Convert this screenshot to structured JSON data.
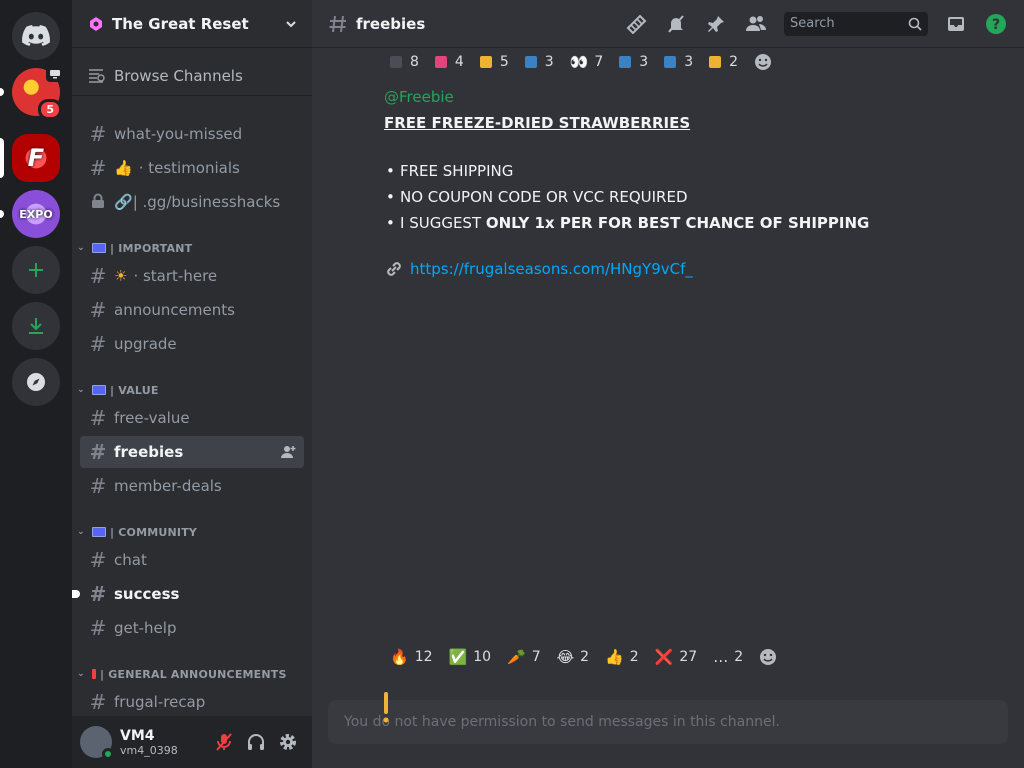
{
  "server": {
    "name": "The Great Reset"
  },
  "rail": {
    "badge_count": "5",
    "server_3_label": "EXPO"
  },
  "sidebar": {
    "browse_label": "Browse Channels",
    "channels_top": [
      {
        "name": "what-you-missed"
      },
      {
        "name": "· testimonials",
        "emoji": "👍"
      },
      {
        "name": "| .gg/businesshacks",
        "emoji": "🔗"
      }
    ],
    "categories": [
      {
        "label": "| IMPORTANT",
        "channels": [
          {
            "name": "· start-here",
            "emoji": "☀"
          },
          {
            "name": "announcements"
          },
          {
            "name": "upgrade"
          }
        ]
      },
      {
        "label": "| VALUE",
        "channels": [
          {
            "name": "free-value"
          },
          {
            "name": "freebies"
          },
          {
            "name": "member-deals"
          }
        ]
      },
      {
        "label": "| COMMUNITY",
        "channels": [
          {
            "name": "chat"
          },
          {
            "name": "success"
          },
          {
            "name": "get-help"
          }
        ]
      },
      {
        "label": "| GENERAL ANNOUNCEMENTS",
        "channels": [
          {
            "name": "frugal-recap"
          }
        ]
      }
    ]
  },
  "user": {
    "name": "VM4",
    "tag": "vm4_0398"
  },
  "topbar": {
    "channel": "freebies",
    "search_placeholder": "Search"
  },
  "reactions_top": [
    {
      "count": "8",
      "color": "#4a4d55"
    },
    {
      "count": "4",
      "color": "#e0457b"
    },
    {
      "count": "5",
      "color": "#f0b232"
    },
    {
      "count": "3",
      "color": "#3b82c4"
    },
    {
      "count": "7",
      "emoji": "👀"
    },
    {
      "count": "3",
      "color": "#3b82c4"
    },
    {
      "count": "3",
      "color": "#3b82c4"
    },
    {
      "count": "2",
      "color": "#f0b232"
    }
  ],
  "message": {
    "mention": "@Freebie",
    "headline": " FREE FREEZE-DRIED STRAWBERRIES",
    "bullets": [
      {
        "text": "FREE SHIPPING"
      },
      {
        "text": "NO COUPON CODE OR VCC REQUIRED"
      },
      {
        "text": "I SUGGEST ",
        "bold": "ONLY 1x PER FOR BEST CHANCE OF SHIPPING"
      }
    ],
    "link": "https://frugalseasons.com/HNgY9vCf_"
  },
  "reactions_bottom": [
    {
      "emoji": "🔥",
      "count": "12"
    },
    {
      "emoji": "✅",
      "count": "10"
    },
    {
      "emoji": "🥕",
      "count": "7"
    },
    {
      "emoji": "😂",
      "count": "2"
    },
    {
      "emoji": "👍",
      "count": "2"
    },
    {
      "emoji": "❌",
      "count": "27"
    },
    {
      "emoji": "…",
      "count": "2"
    }
  ],
  "composer": {
    "text": "You do not have permission to send messages in this channel."
  },
  "colors": {
    "accent": "#5865f2",
    "green": "#23a55a",
    "link": "#00a8fc",
    "red": "#f23f43"
  }
}
